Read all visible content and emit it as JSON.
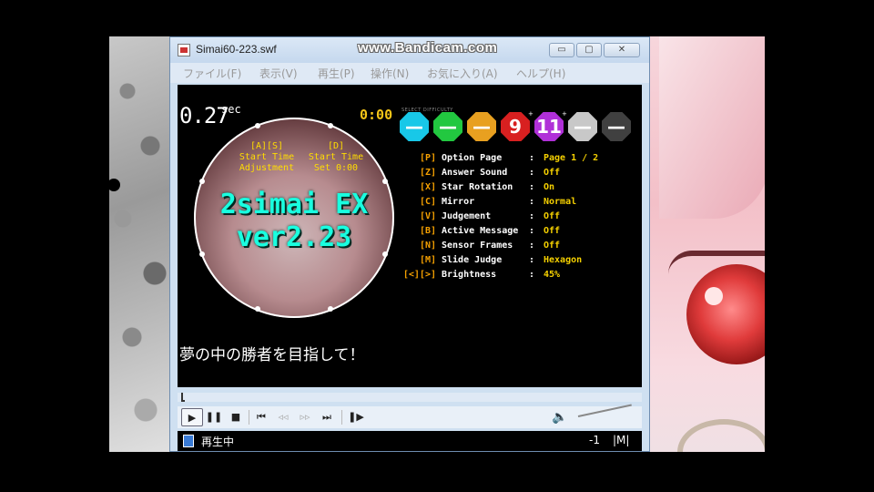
{
  "window": {
    "title": "Simai60-223.swf",
    "overlay": "www.Bandicam.com",
    "controls": {
      "minimize": "▭",
      "maximize": "▢",
      "close": "✕"
    }
  },
  "menu": [
    {
      "label": "ファイル(F)"
    },
    {
      "label": "表示(V)"
    },
    {
      "label": "再生(P)"
    },
    {
      "label": "操作(N)"
    },
    {
      "label": "お気に入り(A)"
    },
    {
      "label": "ヘルプ(H)"
    }
  ],
  "stage": {
    "timer": "0.27",
    "timer_unit": "sec",
    "clock": "0:00",
    "adjust_left": {
      "key": "[A][S]",
      "line1": "Start Time",
      "line2": "Adjustment"
    },
    "adjust_right": {
      "key": "[D]",
      "line1": "Start Time",
      "line2": "Set 0:00"
    },
    "title_line1": "2simai EX",
    "title_line2": "ver2.23",
    "subtitle": "夢の中の勝者を目指して！",
    "difficulty_header": "SELECT DIFFICULTY",
    "difficulties": [
      {
        "value": "—",
        "color": "#18c8e8",
        "sup": ""
      },
      {
        "value": "—",
        "color": "#22c840",
        "sup": ""
      },
      {
        "value": "—",
        "color": "#e8a020",
        "sup": ""
      },
      {
        "value": "9",
        "color": "#d82020",
        "sup": "+"
      },
      {
        "value": "11",
        "color": "#b030d8",
        "sup": "+"
      },
      {
        "value": "—",
        "color": "#c8c8c8",
        "sup": ""
      },
      {
        "value": "—",
        "color": "#404040",
        "sup": ""
      }
    ],
    "options": [
      {
        "key": "[P]",
        "name": "Option Page",
        "value": "Page 1 / 2"
      },
      {
        "key": "[Z]",
        "name": "Answer Sound",
        "value": "Off"
      },
      {
        "key": "[X]",
        "name": "Star Rotation",
        "value": "On"
      },
      {
        "key": "[C]",
        "name": "Mirror",
        "value": "Normal"
      },
      {
        "key": "[V]",
        "name": "Judgement",
        "value": "Off"
      },
      {
        "key": "[B]",
        "name": "Active Message",
        "value": "Off"
      },
      {
        "key": "[N]",
        "name": "Sensor Frames",
        "value": "Off"
      },
      {
        "key": "[M]",
        "name": "Slide Judge",
        "value": "Hexagon"
      },
      {
        "key": "[<][>]",
        "name": "Brightness",
        "value": "45%"
      }
    ]
  },
  "player": {
    "play": "▶",
    "pause": "❚❚",
    "stop": "■",
    "rewind": "⏮",
    "step_back": "◃◃",
    "step_forward": "▹▹",
    "forward": "⏭",
    "frame": "❚▶",
    "volume": "🔈"
  },
  "status": {
    "text": "再生中",
    "count": "-1",
    "mode": "|M|"
  }
}
